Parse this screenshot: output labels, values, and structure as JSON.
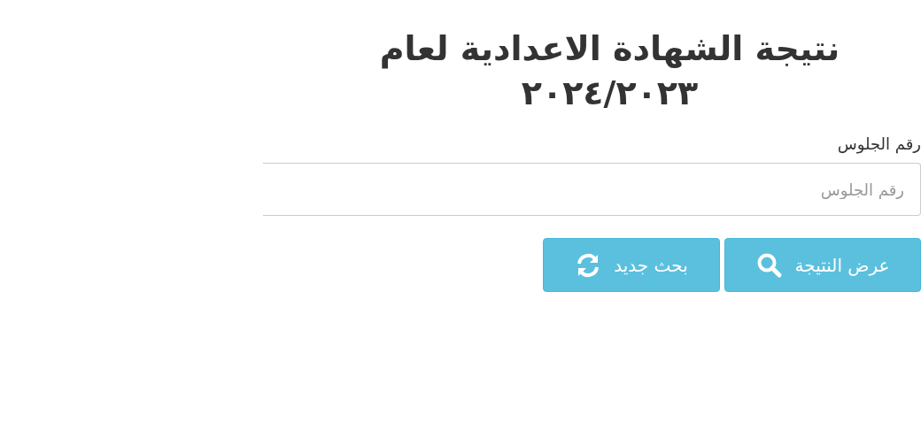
{
  "title": "نتيجة الشهادة الاعدادية لعام ٢٠٢٤/٢٠٢٣",
  "field": {
    "label": "رقم الجلوس",
    "placeholder": "رقم الجلوس"
  },
  "buttons": [
    {
      "label": "عرض النتيجة",
      "kind": "search"
    },
    {
      "label": "بحث جديد",
      "kind": "refresh"
    }
  ]
}
